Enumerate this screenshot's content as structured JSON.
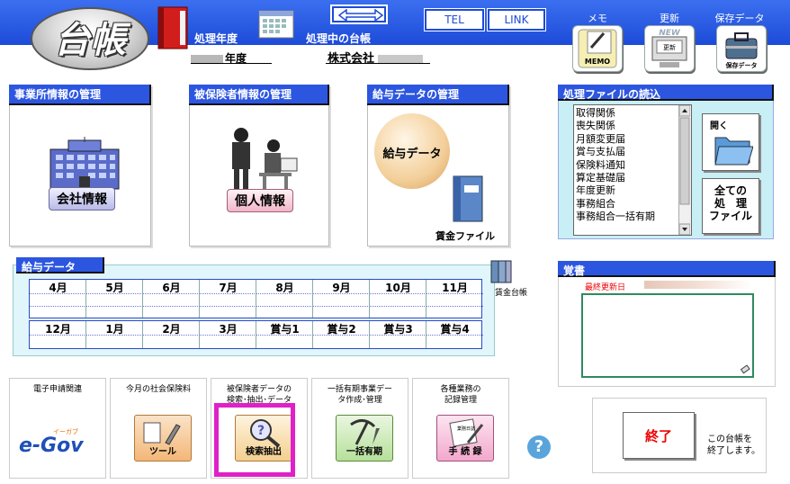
{
  "header": {
    "logo": "台帳",
    "processing_year_label": "処理年度",
    "processing_year_value": "年度",
    "processing_ledger_label": "処理中の台帳",
    "company_value": "株式会社",
    "tel_label": "TEL",
    "link_label": "LINK",
    "memo_label": "メモ",
    "memo_icon_text": "MEMO",
    "update_label": "更新",
    "update_icon_badge": "NEW",
    "update_icon_text": "更新",
    "save_label": "保存データ",
    "save_icon_text": "保存データ"
  },
  "panels": {
    "office": {
      "title": "事業所情報の管理",
      "button": "会社情報"
    },
    "insured": {
      "title": "被保険者情報の管理",
      "button": "個人情報"
    },
    "salary": {
      "title": "給与データの管理",
      "button": "給与データ",
      "sub_label": "賃金ファイル"
    }
  },
  "file_panel": {
    "title": "処理ファイルの読込",
    "items": [
      "取得関係",
      "喪失関係",
      "月額変更届",
      "賞与支払届",
      "保険料通知",
      "算定基礎届",
      "年度更新",
      "事務組合",
      "事務組合一括有期"
    ],
    "open_label": "開く",
    "all_files_label": [
      "全ての",
      "処　理",
      "ファイル"
    ]
  },
  "salary_grid": {
    "title": "給与データ",
    "row1": [
      "4月",
      "5月",
      "6月",
      "7月",
      "8月",
      "9月",
      "10月",
      "11月"
    ],
    "row2": [
      "12月",
      "1月",
      "2月",
      "3月",
      "賞与1",
      "賞与2",
      "賞与3",
      "賞与4"
    ],
    "ledger_label": "賃金台帳"
  },
  "memo_panel": {
    "title": "覚書",
    "last_updated_label": "最終更新日"
  },
  "tools": [
    {
      "title": "電子申請関連",
      "icon_label": "e-Gov",
      "badge": "イーガブ"
    },
    {
      "title": "今月の社会保険料",
      "icon_label": "ツール"
    },
    {
      "title": "被保険者データの\n検索･抽出･データ",
      "icon_label": "検索抽出"
    },
    {
      "title": "一括有期事業デー\nタ作成･管理",
      "icon_label": "一括有期"
    },
    {
      "title": "各種業務の\n記録管理",
      "icon_label": "手 続 録",
      "badge": "業務日誌"
    }
  ],
  "help_label": "?",
  "exit": {
    "button": "終了",
    "note": [
      "この台帳を",
      "終了します。"
    ]
  },
  "colors": {
    "header_blue": "#1d4bd8",
    "tab_blue": "#2c56e0",
    "highlight": "#e020c8",
    "exit_red": "#e00000"
  }
}
